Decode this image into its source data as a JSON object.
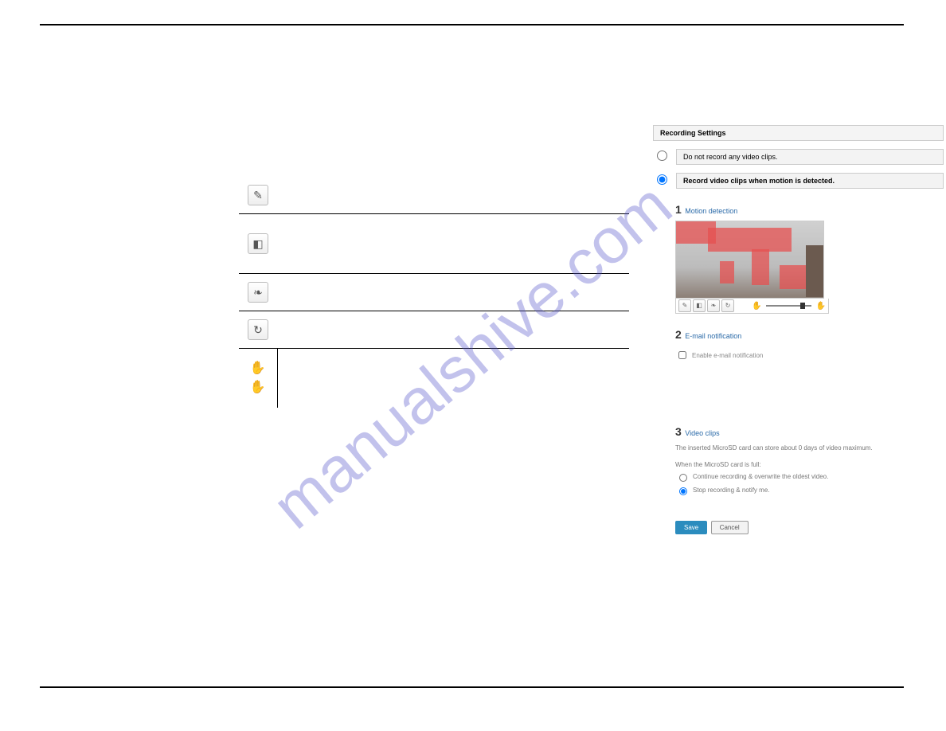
{
  "watermark": "manualshive.com",
  "icons": {
    "pencil": "✎",
    "eraser": "◧",
    "brush": "❧",
    "refresh": "↻",
    "hand_light": "✋",
    "hand_dark": "✋"
  },
  "panel": {
    "header": "Recording Settings",
    "option_none": "Do not record any video clips.",
    "option_motion": "Record video clips when motion is detected.",
    "section1_num": "1",
    "section1_title": "Motion detection",
    "section2_num": "2",
    "section2_title": "E-mail notification",
    "enable_email": "Enable e-mail notification",
    "section3_num": "3",
    "section3_title": "Video clips",
    "storage_text": "The inserted MicroSD card can store about 0 days of video maximum.",
    "full_text": "When the MicroSD card is full:",
    "full_opt1": "Continue recording & overwrite the oldest video.",
    "full_opt2": "Stop recording & notify me.",
    "save": "Save",
    "cancel": "Cancel"
  }
}
